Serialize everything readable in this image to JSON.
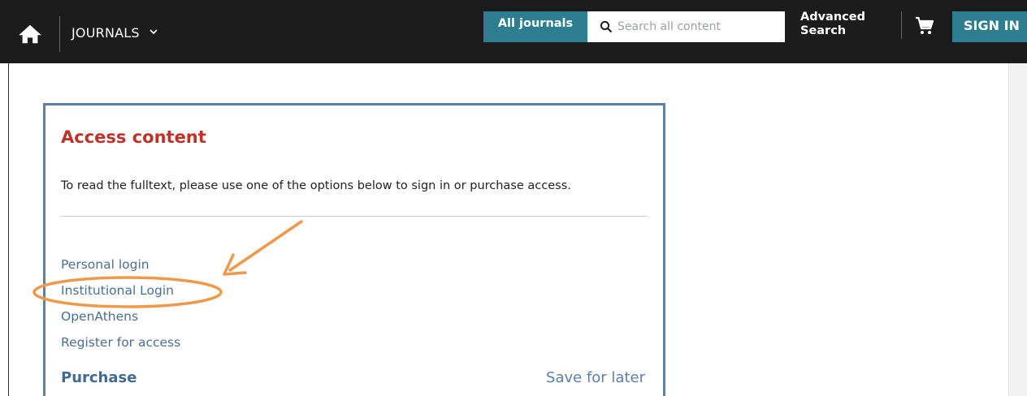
{
  "header": {
    "home_icon": "home-icon",
    "journals_label": "JOURNALS",
    "all_journals_label": "All journals",
    "search_placeholder": "Search all content",
    "advanced_search_line1": "Advanced",
    "advanced_search_line2": "Search",
    "cart_icon": "cart-icon",
    "sign_in_label": "SIGN IN"
  },
  "access": {
    "title": "Access content",
    "description": "To read the fulltext, please use one of the options below to sign in or purchase access.",
    "links": [
      "Personal login",
      "Institutional Login",
      "OpenAthens",
      "Register for access"
    ],
    "purchase_heading": "Purchase",
    "save_for_later": "Save for later"
  },
  "colors": {
    "topbar": "#1c1c1c",
    "accent_teal": "#2d7e90",
    "card_border": "#5b7fa6",
    "title_red": "#c0312a",
    "link_blue": "#4a6f95",
    "annotation_orange": "#f0994a"
  }
}
